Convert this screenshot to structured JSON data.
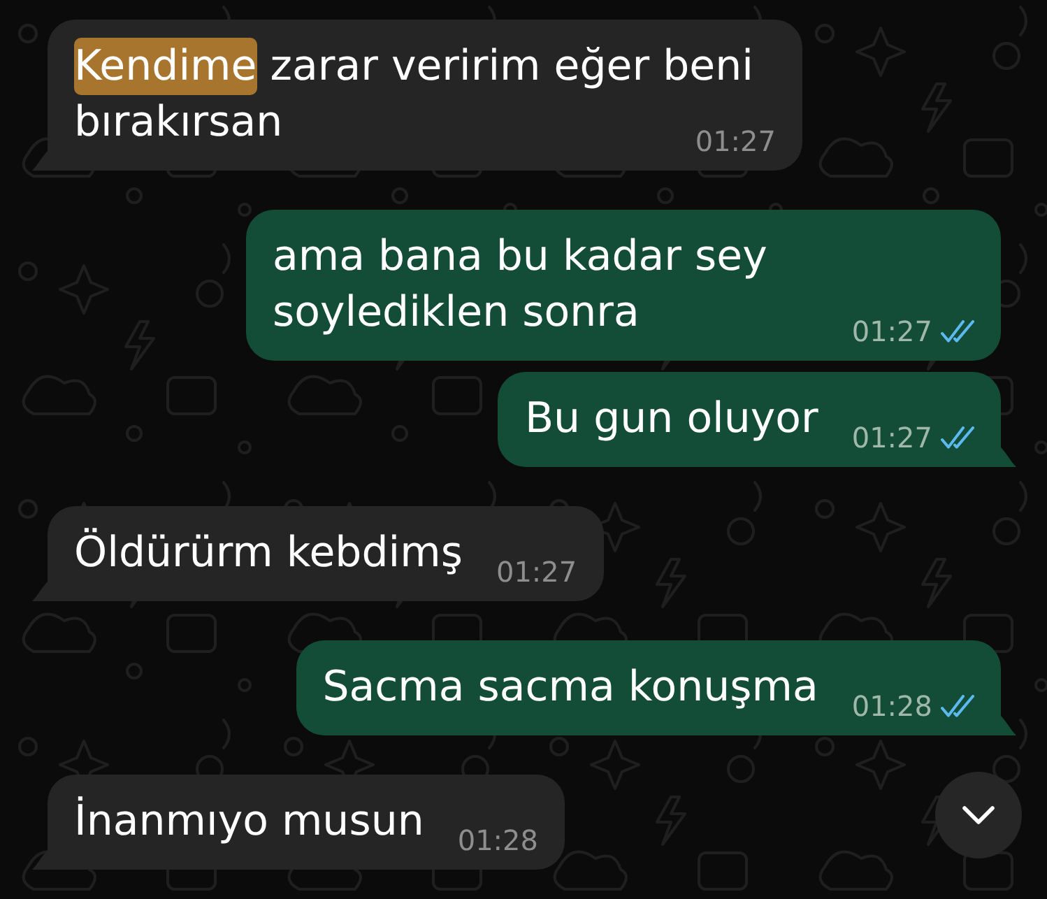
{
  "messages": [
    {
      "kind": "incoming",
      "parts": [
        {
          "text": "Kendime",
          "highlighted": true
        },
        {
          "text": " zarar veririm eğer beni bırakırsan",
          "highlighted": false
        }
      ],
      "time": "01:27"
    },
    {
      "kind": "outgoing",
      "parts": [
        {
          "text": "ama bana bu kadar sey soylediklen sonra",
          "highlighted": false
        }
      ],
      "time": "01:27",
      "read": true
    },
    {
      "kind": "outgoing",
      "parts": [
        {
          "text": "Bu gun oluyor",
          "highlighted": false
        }
      ],
      "time": "01:27",
      "read": true
    },
    {
      "kind": "incoming",
      "parts": [
        {
          "text": "Öldürürm kebdimş",
          "highlighted": false
        }
      ],
      "time": "01:27"
    },
    {
      "kind": "outgoing",
      "parts": [
        {
          "text": "Sacma sacma konuşma",
          "highlighted": false
        }
      ],
      "time": "01:28",
      "read": true
    },
    {
      "kind": "incoming",
      "parts": [
        {
          "text": "İnanmıyo musun",
          "highlighted": false
        }
      ],
      "time": "01:28"
    }
  ]
}
